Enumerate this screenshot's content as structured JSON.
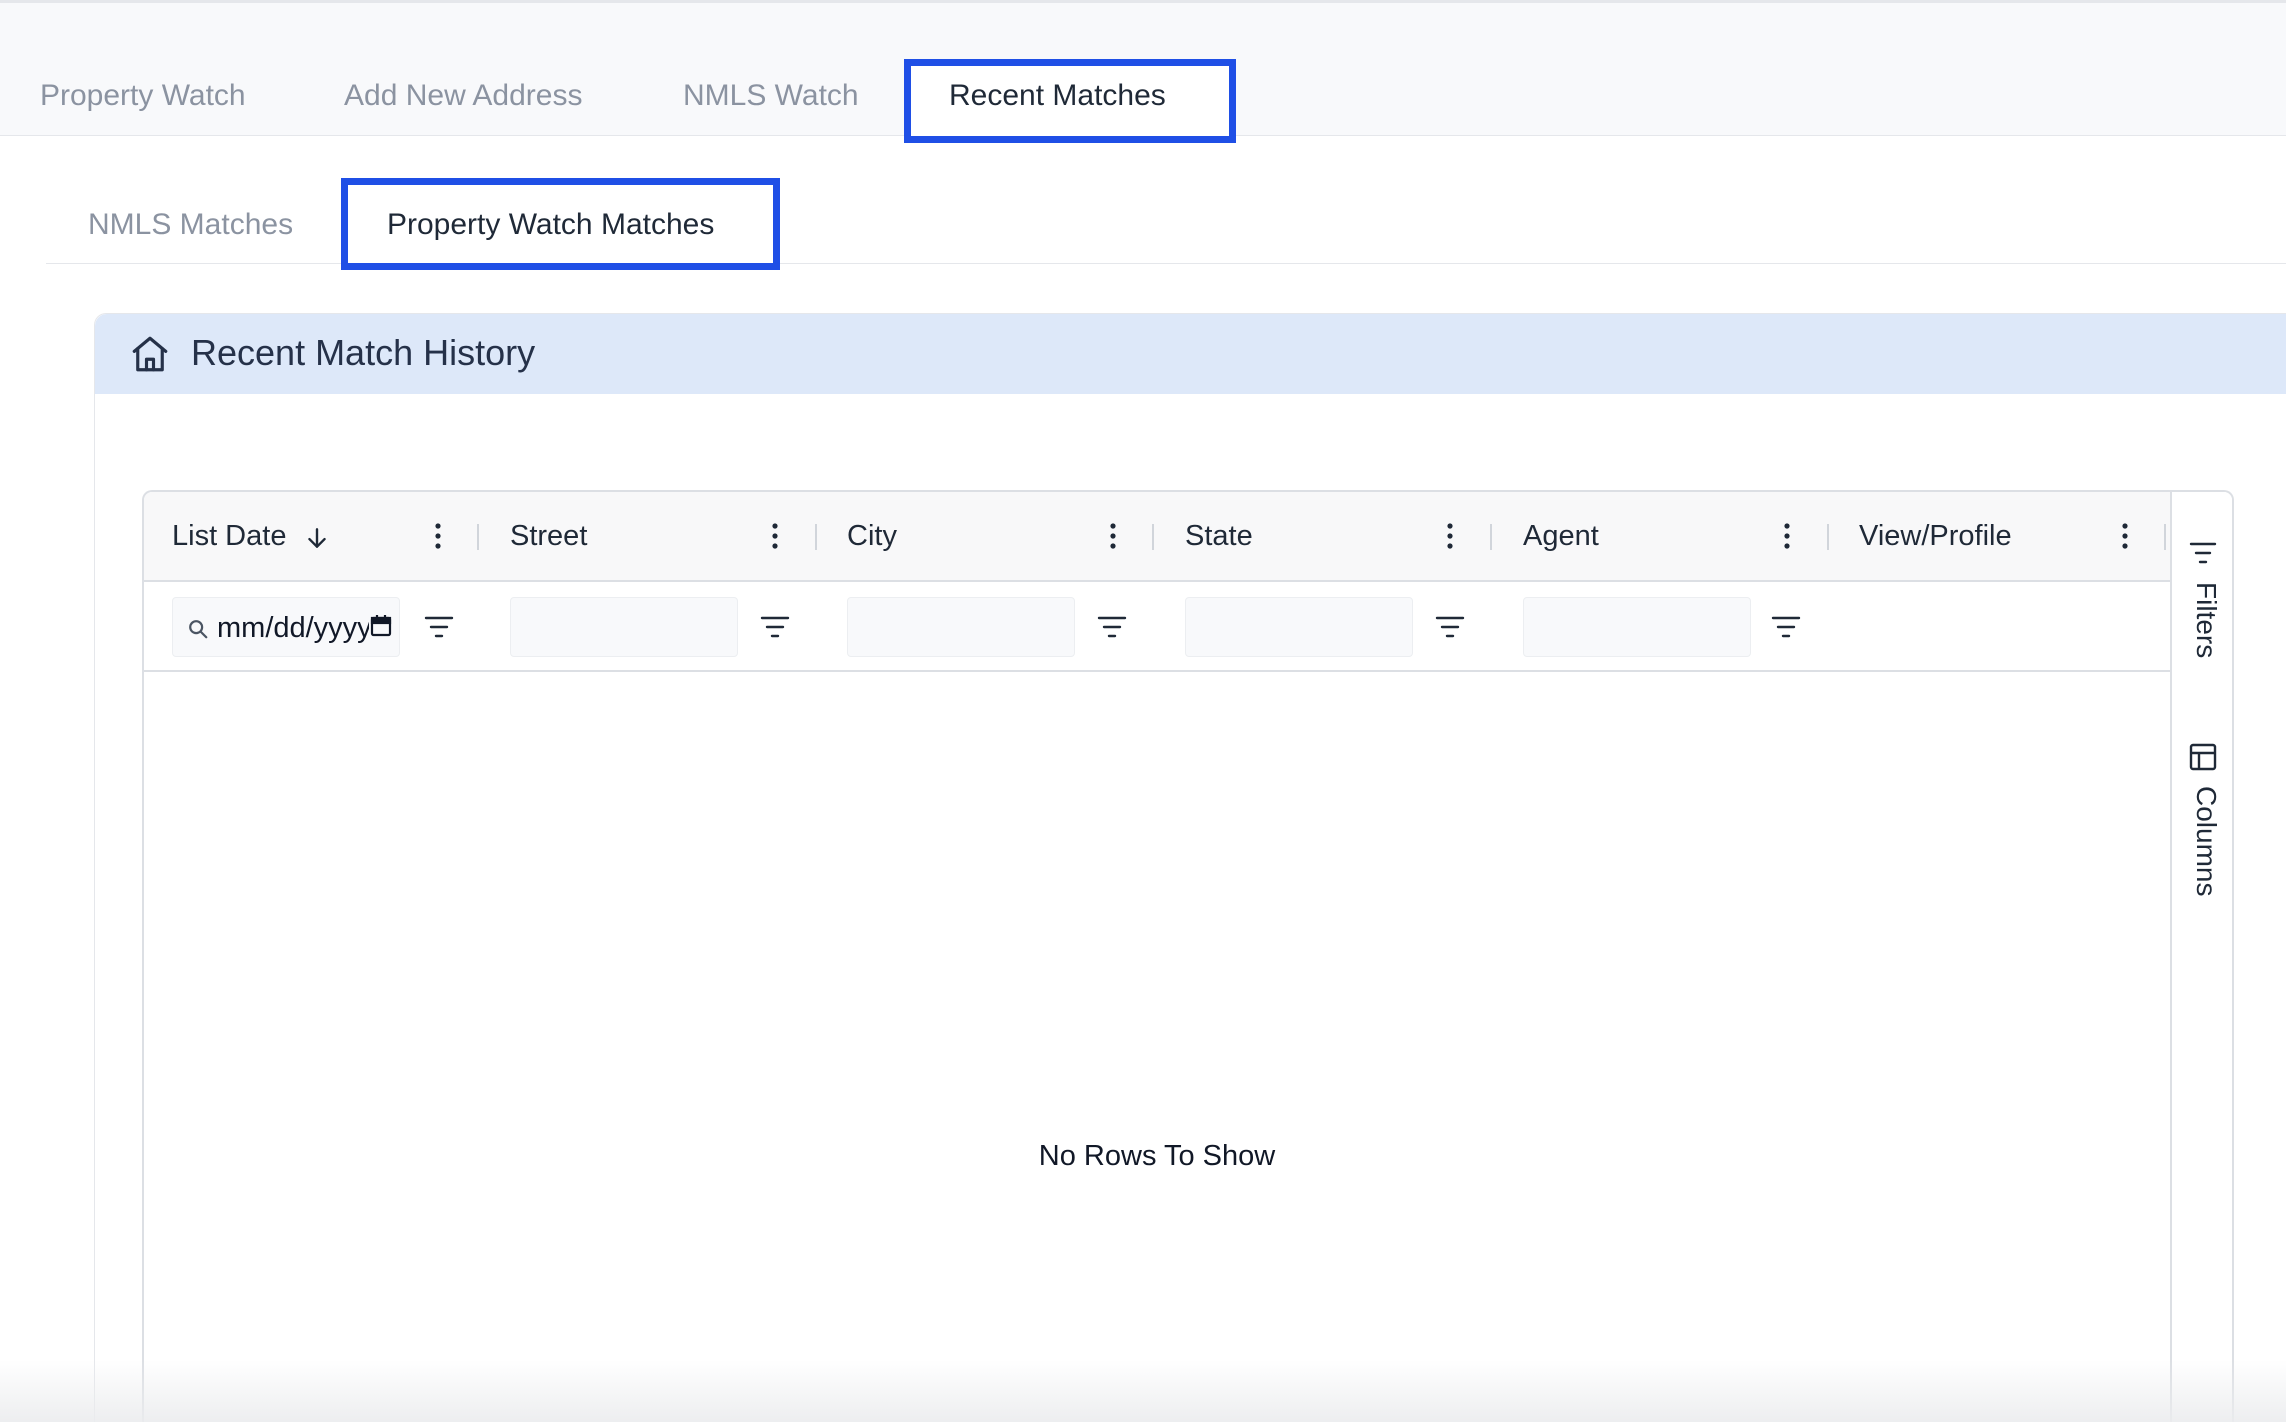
{
  "top_tabs": [
    {
      "label": "Property Watch",
      "active": false
    },
    {
      "label": "Add New Address",
      "active": false
    },
    {
      "label": "NMLS Watch",
      "active": false
    },
    {
      "label": "Recent Matches",
      "active": true
    }
  ],
  "sub_tabs": [
    {
      "label": "NMLS Matches",
      "active": false
    },
    {
      "label": "Property Watch Matches",
      "active": true
    }
  ],
  "card": {
    "title": "Recent Match History",
    "icon": "home-icon"
  },
  "grid": {
    "columns": [
      {
        "label": "List Date",
        "sorted": "descending"
      },
      {
        "label": "Street"
      },
      {
        "label": "City"
      },
      {
        "label": "State"
      },
      {
        "label": "Agent"
      },
      {
        "label": "View/Profile"
      }
    ],
    "date_filter_placeholder": "mm/dd/yyyy",
    "empty_message": "No Rows To Show",
    "side_panel": {
      "filters_label": "Filters",
      "columns_label": "Columns"
    }
  },
  "colors": {
    "highlight": "#1f4fe6",
    "card_header_bg": "#dde8f9",
    "muted_text": "#8b93a1"
  }
}
